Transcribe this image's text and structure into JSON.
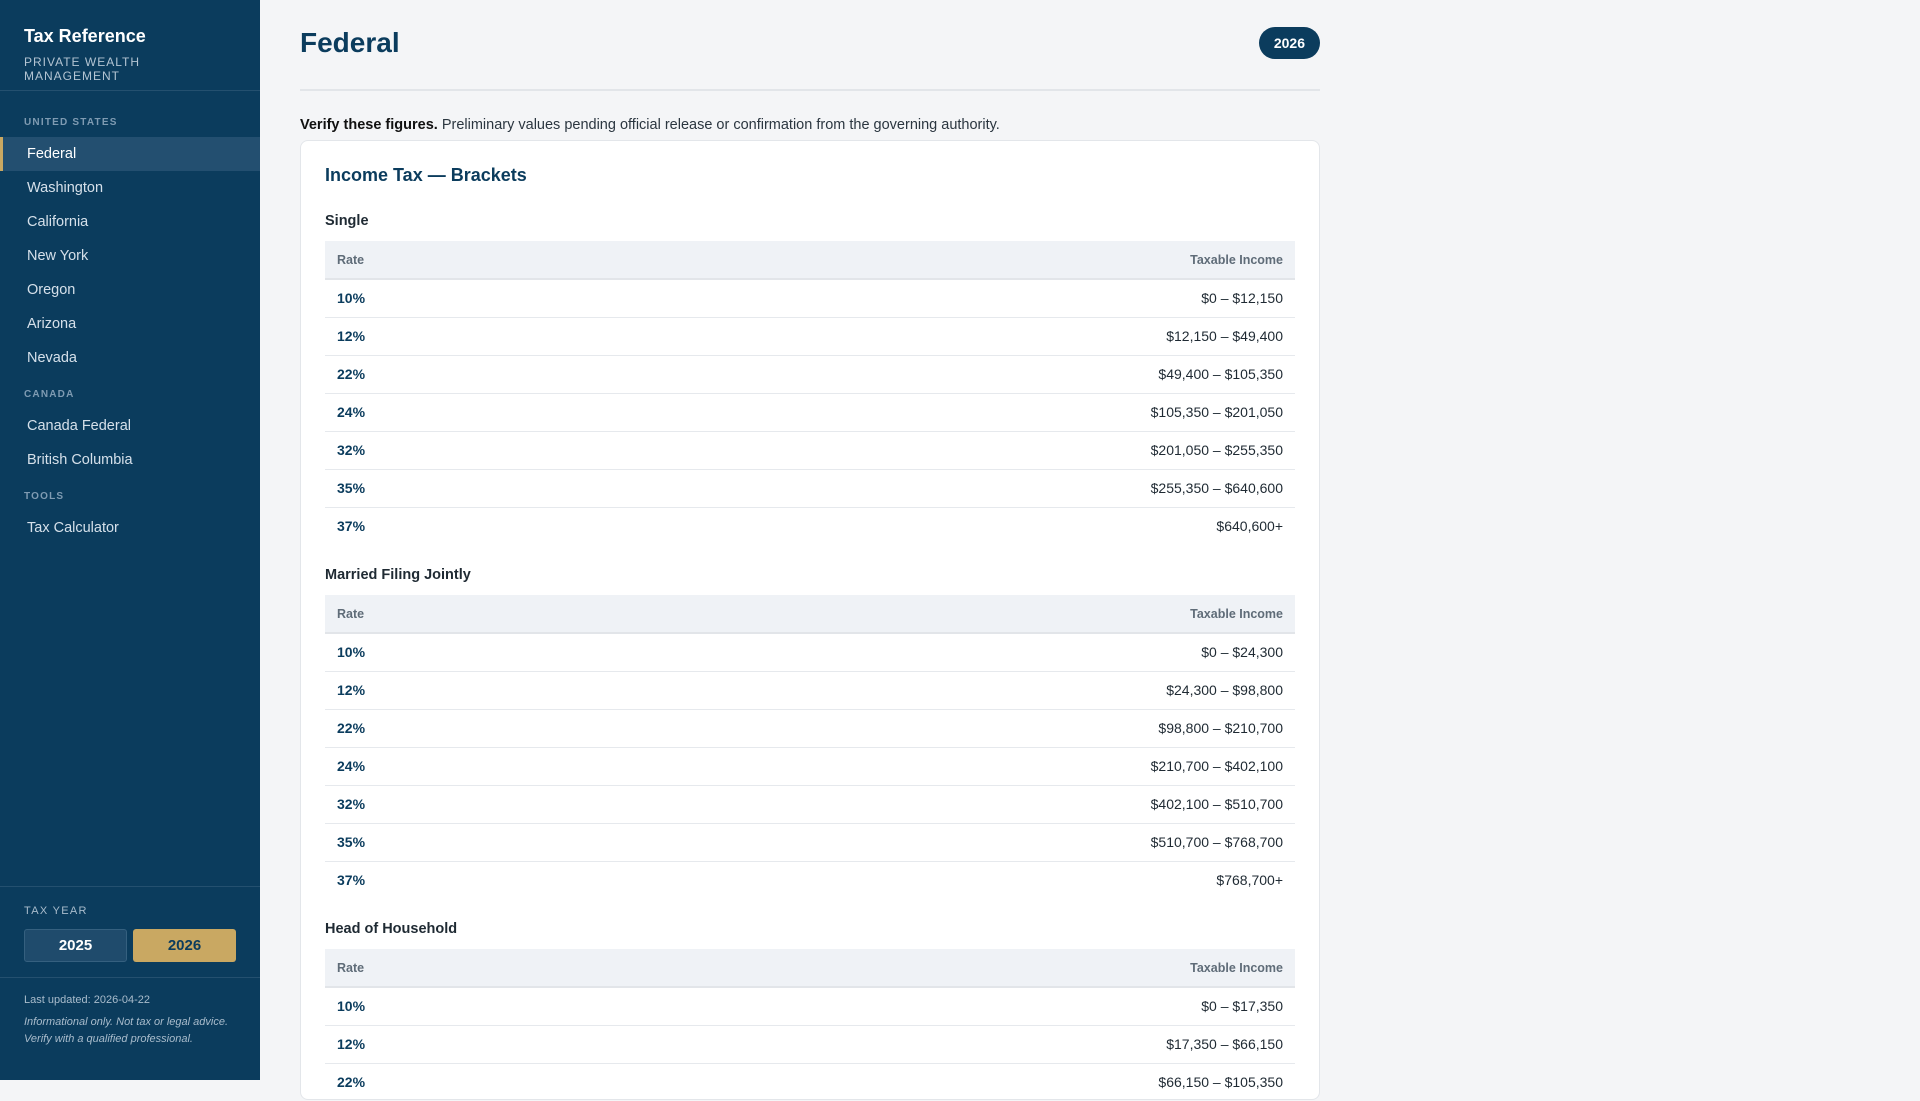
{
  "sidebar": {
    "title": "Tax Reference",
    "subtitle": "PRIVATE WEALTH MANAGEMENT",
    "sections": [
      {
        "label": "UNITED STATES",
        "items": [
          "Federal",
          "Washington",
          "California",
          "New York",
          "Oregon",
          "Arizona",
          "Nevada"
        ]
      },
      {
        "label": "CANADA",
        "items": [
          "Canada Federal",
          "British Columbia"
        ]
      },
      {
        "label": "TOOLS",
        "items": [
          "Tax Calculator"
        ]
      }
    ],
    "active_item": "Federal",
    "tax_year_label": "TAX YEAR",
    "years": [
      "2025",
      "2026"
    ],
    "selected_year": "2026",
    "last_updated": "Last updated: 2026-04-22",
    "disclaimer_1": "Informational only. Not tax or legal advice.",
    "disclaimer_2": "Verify with a qualified professional."
  },
  "main": {
    "title": "Federal",
    "year_badge": "2026",
    "notice_bold": "Verify these figures.",
    "notice_text": " Preliminary values pending official release or confirmation from the governing authority.",
    "card_title": "Income Tax — Brackets",
    "col_rate": "Rate",
    "col_income": "Taxable Income",
    "groups": [
      {
        "label": "Single",
        "rows": [
          [
            "10%",
            "$0 – $12,150"
          ],
          [
            "12%",
            "$12,150 – $49,400"
          ],
          [
            "22%",
            "$49,400 – $105,350"
          ],
          [
            "24%",
            "$105,350 – $201,050"
          ],
          [
            "32%",
            "$201,050 – $255,350"
          ],
          [
            "35%",
            "$255,350 – $640,600"
          ],
          [
            "37%",
            "$640,600+"
          ]
        ]
      },
      {
        "label": "Married Filing Jointly",
        "rows": [
          [
            "10%",
            "$0 – $24,300"
          ],
          [
            "12%",
            "$24,300 – $98,800"
          ],
          [
            "22%",
            "$98,800 – $210,700"
          ],
          [
            "24%",
            "$210,700 – $402,100"
          ],
          [
            "32%",
            "$402,100 – $510,700"
          ],
          [
            "35%",
            "$510,700 – $768,700"
          ],
          [
            "37%",
            "$768,700+"
          ]
        ]
      },
      {
        "label": "Head of Household",
        "rows": [
          [
            "10%",
            "$0 – $17,350"
          ],
          [
            "12%",
            "$17,350 – $66,150"
          ],
          [
            "22%",
            "$66,150 – $105,350"
          ]
        ]
      }
    ]
  }
}
